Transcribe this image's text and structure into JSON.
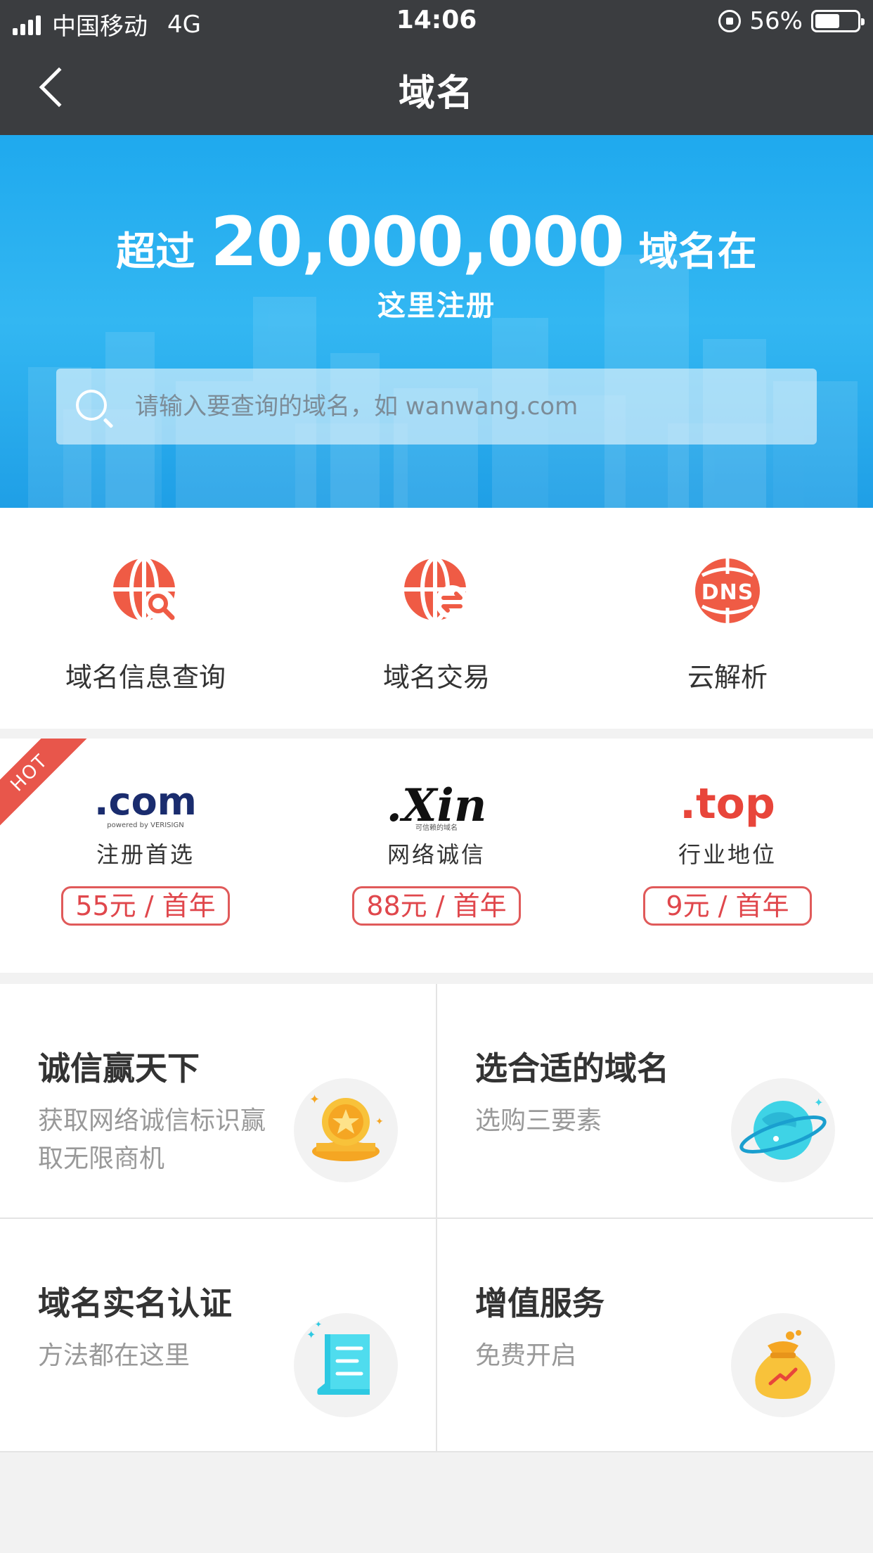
{
  "status_bar": {
    "carrier": "中国移动",
    "network": "4G",
    "time": "14:06",
    "battery": "56%",
    "battery_level": 0.56
  },
  "nav": {
    "title": "域名"
  },
  "banner": {
    "prefix": "超过",
    "count": "20,000,000",
    "suffix": "域名在",
    "line2": "这里注册",
    "search_placeholder": "请输入要查询的域名，如 wanwang.com"
  },
  "services": [
    {
      "label": "域名信息查询",
      "icon": "globe-search-icon"
    },
    {
      "label": "域名交易",
      "icon": "globe-exchange-icon"
    },
    {
      "label": "云解析",
      "icon": "dns-globe-icon"
    }
  ],
  "promos": {
    "hot": "HOT",
    "items": [
      {
        "brand": ".com",
        "brand_sub": "powered by VERISIGN",
        "tag": "注册首选",
        "price": "55元 / 首年"
      },
      {
        "brand": ".Xin",
        "brand_sub": "可信赖的域名",
        "tag": "网络诚信",
        "price": "88元 / 首年"
      },
      {
        "brand": ".top",
        "tag": "行业地位",
        "price": "9元 / 首年"
      }
    ]
  },
  "features": [
    {
      "title": "诚信赢天下",
      "desc": "获取网络诚信标识赢取无限商机",
      "icon": "gold-coin-icon"
    },
    {
      "title": "选合适的域名",
      "desc": "选购三要素",
      "icon": "planet-icon"
    },
    {
      "title": "域名实名认证",
      "desc": "方法都在这里",
      "icon": "document-scroll-icon"
    },
    {
      "title": "增值服务",
      "desc": "免费开启",
      "icon": "money-bag-icon"
    }
  ],
  "colors": {
    "nav_bg": "#3b3d40",
    "banner_blue": "#1fa9ee",
    "accent_red": "#e8453a",
    "price_red": "#e0474c"
  }
}
